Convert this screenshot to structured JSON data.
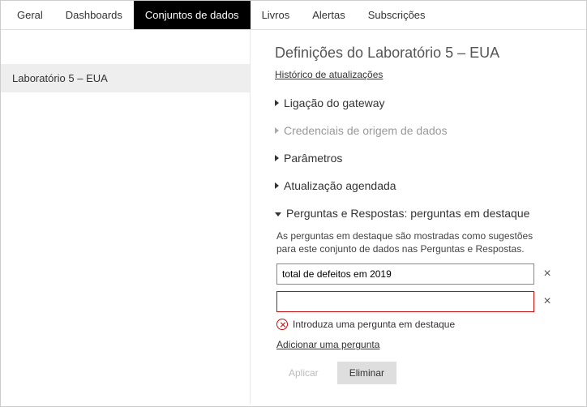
{
  "tabs": {
    "geral": "Geral",
    "dashboards": "Dashboards",
    "conjuntos": "Conjuntos de dados",
    "livros": "Livros",
    "alertas": "Alertas",
    "subscricoes": "Subscrições"
  },
  "sidebar": {
    "item0": "Laboratório 5 – EUA"
  },
  "title": "Definições do Laboratório 5 – EUA",
  "history_link": "Histórico de atualizações",
  "sections": {
    "gateway": "Ligação do gateway",
    "credentials": "Credenciais de origem de dados",
    "parameters": "Parâmetros",
    "scheduled": "Atualização agendada",
    "qna": "Perguntas e Respostas: perguntas em destaque"
  },
  "qna": {
    "desc": "As perguntas em destaque são mostradas como sugestões para este conjunto de dados nas Perguntas e Respostas.",
    "input1": "total de defeitos em 2019",
    "input2": "",
    "error_msg": "Introduza uma pergunta em destaque",
    "add_link": "Adicionar uma pergunta",
    "apply": "Aplicar",
    "delete": "Eliminar"
  }
}
